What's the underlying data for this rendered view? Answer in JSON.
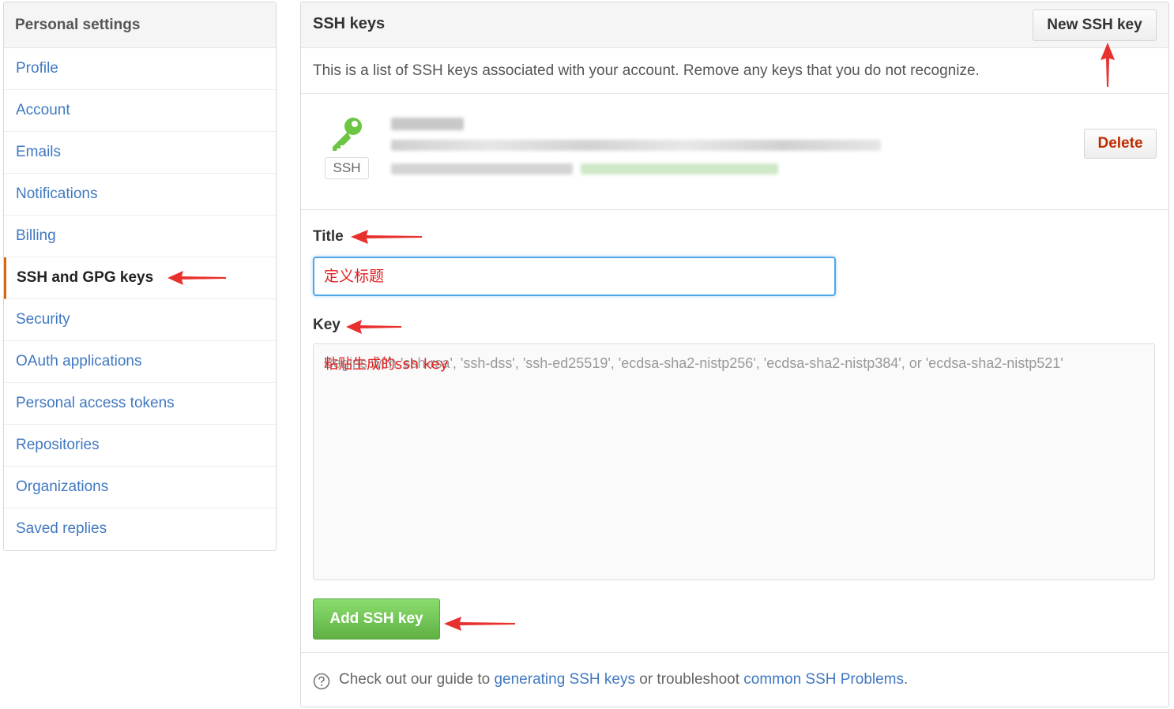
{
  "sidebar": {
    "title": "Personal settings",
    "items": [
      {
        "label": "Profile"
      },
      {
        "label": "Account"
      },
      {
        "label": "Emails"
      },
      {
        "label": "Notifications"
      },
      {
        "label": "Billing"
      },
      {
        "label": "SSH and GPG keys",
        "selected": true
      },
      {
        "label": "Security"
      },
      {
        "label": "OAuth applications"
      },
      {
        "label": "Personal access tokens"
      },
      {
        "label": "Repositories"
      },
      {
        "label": "Organizations"
      },
      {
        "label": "Saved replies"
      }
    ]
  },
  "main": {
    "title": "SSH keys",
    "new_button": "New SSH key",
    "description": "This is a list of SSH keys associated with your account. Remove any keys that you do not recognize.",
    "key": {
      "badge": "SSH",
      "delete_button": "Delete"
    },
    "form": {
      "title_label": "Title",
      "title_value": "定义标题",
      "key_label": "Key",
      "key_placeholder": "Begins with 'ssh-rsa', 'ssh-dss', 'ssh-ed25519', 'ecdsa-sha2-nistp256', 'ecdsa-sha2-nistp384', or 'ecdsa-sha2-nistp521'",
      "key_overlay": "粘贴生成的ssh key",
      "submit_button": "Add SSH key"
    },
    "footer": {
      "prefix": "Check out our guide to ",
      "link1": "generating SSH keys",
      "middle": " or troubleshoot ",
      "link2": "common SSH Problems",
      "suffix": "."
    }
  },
  "colors": {
    "link": "#4078c0",
    "selected_accent": "#d26911",
    "annotation_red": "#e02020",
    "green_button": "#60b044"
  }
}
